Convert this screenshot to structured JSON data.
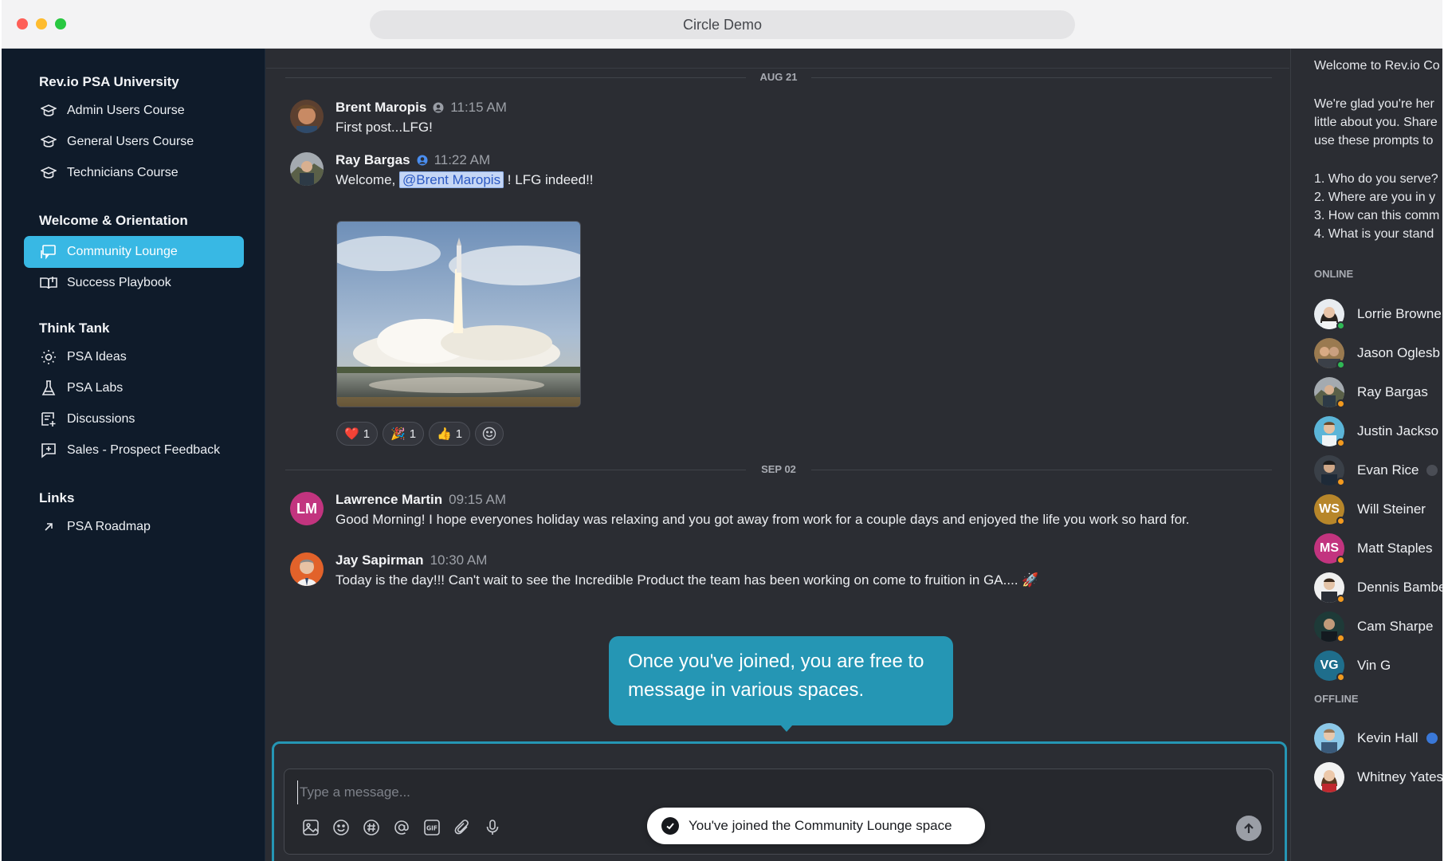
{
  "window": {
    "title": "Circle Demo"
  },
  "sidebar": {
    "sections": [
      {
        "title": "Rev.io PSA University",
        "items": [
          {
            "label": "Admin Users Course",
            "icon": "graduation-cap-icon"
          },
          {
            "label": "General Users Course",
            "icon": "graduation-cap-icon"
          },
          {
            "label": "Technicians Course",
            "icon": "graduation-cap-icon"
          }
        ]
      },
      {
        "title": "Welcome & Orientation",
        "items": [
          {
            "label": "Community Lounge",
            "icon": "chat-board-icon",
            "active": true
          },
          {
            "label": "Success Playbook",
            "icon": "book-icon"
          }
        ]
      },
      {
        "title": "Think Tank",
        "items": [
          {
            "label": "PSA Ideas",
            "icon": "lightbulb-icon"
          },
          {
            "label": "PSA Labs",
            "icon": "flask-icon"
          },
          {
            "label": "Discussions",
            "icon": "discussion-icon"
          },
          {
            "label": "Sales - Prospect Feedback",
            "icon": "feedback-icon"
          }
        ]
      },
      {
        "title": "Links",
        "items": [
          {
            "label": "PSA Roadmap",
            "icon": "external-arrow-icon"
          }
        ]
      }
    ]
  },
  "chat": {
    "dates": [
      "AUG 21",
      "SEP 02"
    ],
    "messages": [
      {
        "name": "Brent Maropis",
        "time": "11:15 AM",
        "text": "First post...LFG!"
      },
      {
        "name": "Ray Bargas",
        "time": "11:22 AM",
        "text_before": "Welcome, ",
        "mention": "@Brent Maropis",
        "text_after": " !  LFG indeed!!"
      },
      {
        "name": "Lawrence Martin",
        "initials": "LM",
        "time": "09:15 AM",
        "text": "Good Morning! I hope everyones holiday was relaxing and you got away from work for a couple days and enjoyed the life you work so hard for."
      },
      {
        "name": "Jay Sapirman",
        "time": "10:30 AM",
        "text": "Today is the day!!!  Can't wait to see the Incredible Product the team has been working on come to fruition in GA.... 🚀"
      }
    ],
    "reactions": [
      {
        "emoji": "❤️",
        "count": "1"
      },
      {
        "emoji": "🎉",
        "count": "1"
      },
      {
        "emoji": "👍",
        "count": "1"
      }
    ]
  },
  "tooltip": {
    "text": "Once you've joined, you are free to message in various spaces."
  },
  "composer": {
    "placeholder": "Type a message..."
  },
  "toast": {
    "text": "You've joined the Community Lounge space"
  },
  "right_panel": {
    "intro_title": "Welcome to Rev.io Co",
    "intro_lines": [
      "We're glad you're her",
      "little about you. Share",
      "use these prompts to"
    ],
    "prompts": [
      "1. Who do you serve?",
      "2. Where are you in y",
      "3. How can this comm",
      "4. What is your stand"
    ],
    "online_label": "ONLINE",
    "online": [
      {
        "name": "Lorrie Browne",
        "status": "green"
      },
      {
        "name": "Jason Oglesb",
        "status": "green"
      },
      {
        "name": "Ray Bargas",
        "status": "orange"
      },
      {
        "name": "Justin Jackso",
        "status": "orange"
      },
      {
        "name": "Evan Rice",
        "status": "orange"
      },
      {
        "name": "Will Steiner",
        "initials": "WS",
        "status": "orange"
      },
      {
        "name": "Matt Staples",
        "initials": "MS",
        "status": "orange"
      },
      {
        "name": "Dennis Bambe",
        "status": "orange"
      },
      {
        "name": "Cam Sharpe",
        "status": "orange"
      },
      {
        "name": "Vin G",
        "initials": "VG",
        "status": "orange"
      }
    ],
    "offline_label": "OFFLINE",
    "offline": [
      {
        "name": "Kevin Hall"
      },
      {
        "name": "Whitney Yates"
      }
    ]
  },
  "colors": {
    "accent": "#38b8e4",
    "tooltip": "#2596b4",
    "online": "#2fb855",
    "away": "#f39a1e"
  }
}
